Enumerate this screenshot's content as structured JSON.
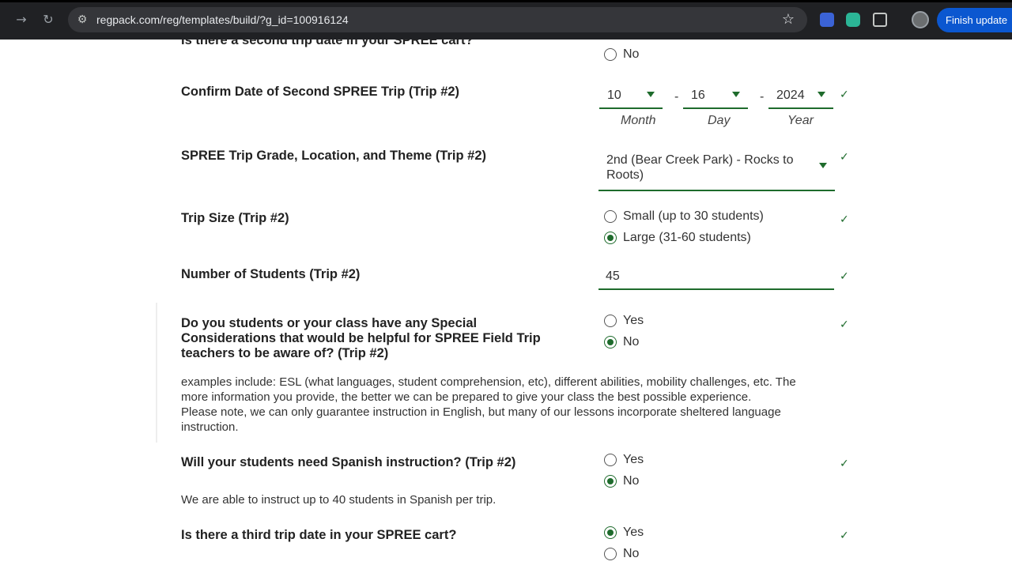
{
  "browser": {
    "url": "regpack.com/reg/templates/build/?g_id=100916124",
    "finish_update_label": "Finish update"
  },
  "form": {
    "prev_question_cut": "Is there a second trip date in your SPREE cart?",
    "prev_no_label": "No",
    "date_question": "Confirm Date of Second SPREE Trip (Trip #2)",
    "month_value": "10",
    "day_value": "16",
    "year_value": "2024",
    "dash": "-",
    "month_label": "Month",
    "day_label": "Day",
    "year_label": "Year",
    "theme_question": "SPREE Trip Grade, Location, and Theme (Trip #2)",
    "theme_value_line1": "2nd (Bear Creek Park) - Rocks to",
    "theme_value_line2": "Roots)",
    "size_question": "Trip Size (Trip #2)",
    "size_small": "Small (up to 30 students)",
    "size_large": "Large (31-60 students)",
    "students_question": "Number of Students (Trip #2)",
    "students_value": "45",
    "special_question_line1": "Do you students or your class have any Special",
    "special_question_line2": "Considerations that would be helpful for SPREE Field Trip",
    "special_question_line3": "teachers to be aware of? (Trip #2)",
    "yes_label": "Yes",
    "no_label": "No",
    "special_help_line1": "examples include: ESL (what languages, student comprehension, etc), different abilities, mobility challenges, etc. The",
    "special_help_line2": "more information you provide, the better we can be prepared to give your class the best possible experience.",
    "special_help_line3": "Please note, we can only guarantee instruction in English, but many of our lessons incorporate sheltered language",
    "special_help_line4": "instruction.",
    "spanish_question": "Will your students need Spanish instruction? (Trip #2)",
    "spanish_help": "We are able to instruct up to 40 students in Spanish per trip.",
    "third_question": "Is there a third trip date in your SPREE cart?",
    "check": "✓"
  },
  "colors": {
    "accent": "#1e6b2c",
    "chrome_bg": "#202124",
    "update_button": "#0b57d0"
  }
}
